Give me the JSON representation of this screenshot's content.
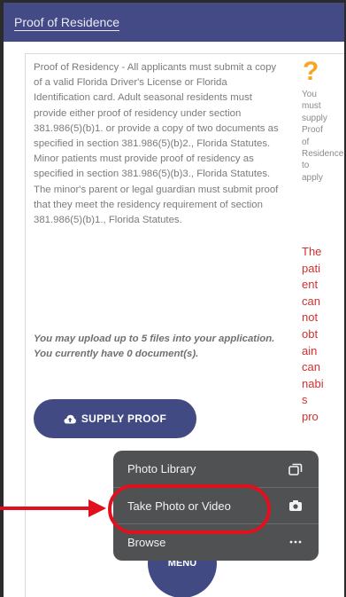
{
  "header": {
    "title": "Proof of Residence"
  },
  "main": {
    "body_text": "Proof of Residency - All applicants must submit a copy of a valid Florida Driver's License or Florida Identification card. Adult seasonal residents must provide either proof of residency under section 381.986(5)(b)1. or provide a copy of two documents as specified in section 381.986(5)(b)2., Florida Statutes. Minor patients must provide proof of residency as specified in section 381.986(5)(b)3., Florida Statutes. The minor's parent or legal guardian must submit proof that they meet the residency requirement of section 381.986(5)(b)1., Florida Statutes.",
    "upload_note": "You may upload up to 5 files into your application. You currently have 0 document(s).",
    "supply_button_label": "SUPPLY PROOF"
  },
  "side": {
    "question_glyph": "?",
    "note": "You\nmust\nsupply\nProof\nof\nResidence\nto\napply",
    "warning": "The\npati\nent\ncan\nnot\nobt\nain\ncan\nnabi\ns\npro"
  },
  "popup_menu": {
    "items": [
      {
        "label": "Photo Library",
        "icon": "photo-library-icon"
      },
      {
        "label": "Take Photo or Video",
        "icon": "camera-icon"
      },
      {
        "label": "Browse",
        "icon": "more-icon"
      }
    ]
  },
  "menu_button": {
    "label": "MENU",
    "glyph": "="
  },
  "colors": {
    "header_bg": "#434a86",
    "button_bg": "#424a84",
    "warning_text": "#d0312d",
    "question_icon": "#f5a623",
    "highlight": "#e0101d",
    "popup_bg": "#505153"
  }
}
